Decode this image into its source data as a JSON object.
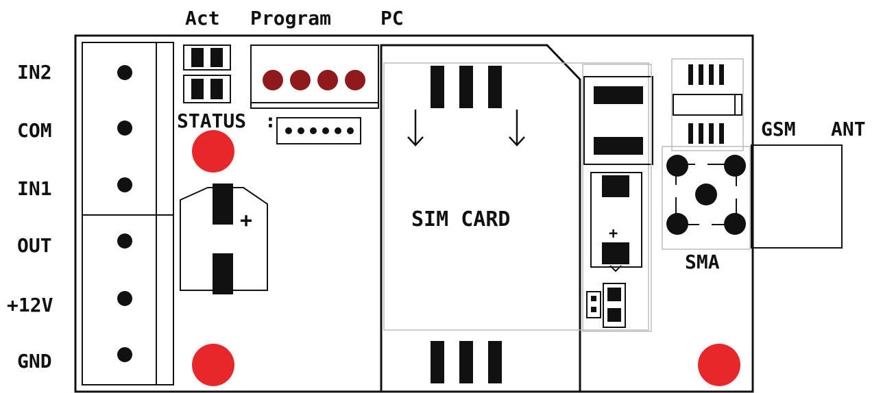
{
  "header": {
    "act": "Act",
    "program": "Program",
    "pc": "PC"
  },
  "terminals": [
    {
      "label": "IN2"
    },
    {
      "label": "COM"
    },
    {
      "label": "IN1"
    },
    {
      "label": "OUT"
    },
    {
      "label": "+12V"
    },
    {
      "label": "GND"
    }
  ],
  "status_label": "STATUS",
  "sim_card_label": "SIM CARD",
  "antenna": {
    "gsm": "GSM",
    "ant": "ANT",
    "sma": "SMA"
  },
  "polarity_plus": "+",
  "colors": {
    "led_red": "#e8272b",
    "program_led": "#8e1a1c",
    "outline": "#111111"
  }
}
